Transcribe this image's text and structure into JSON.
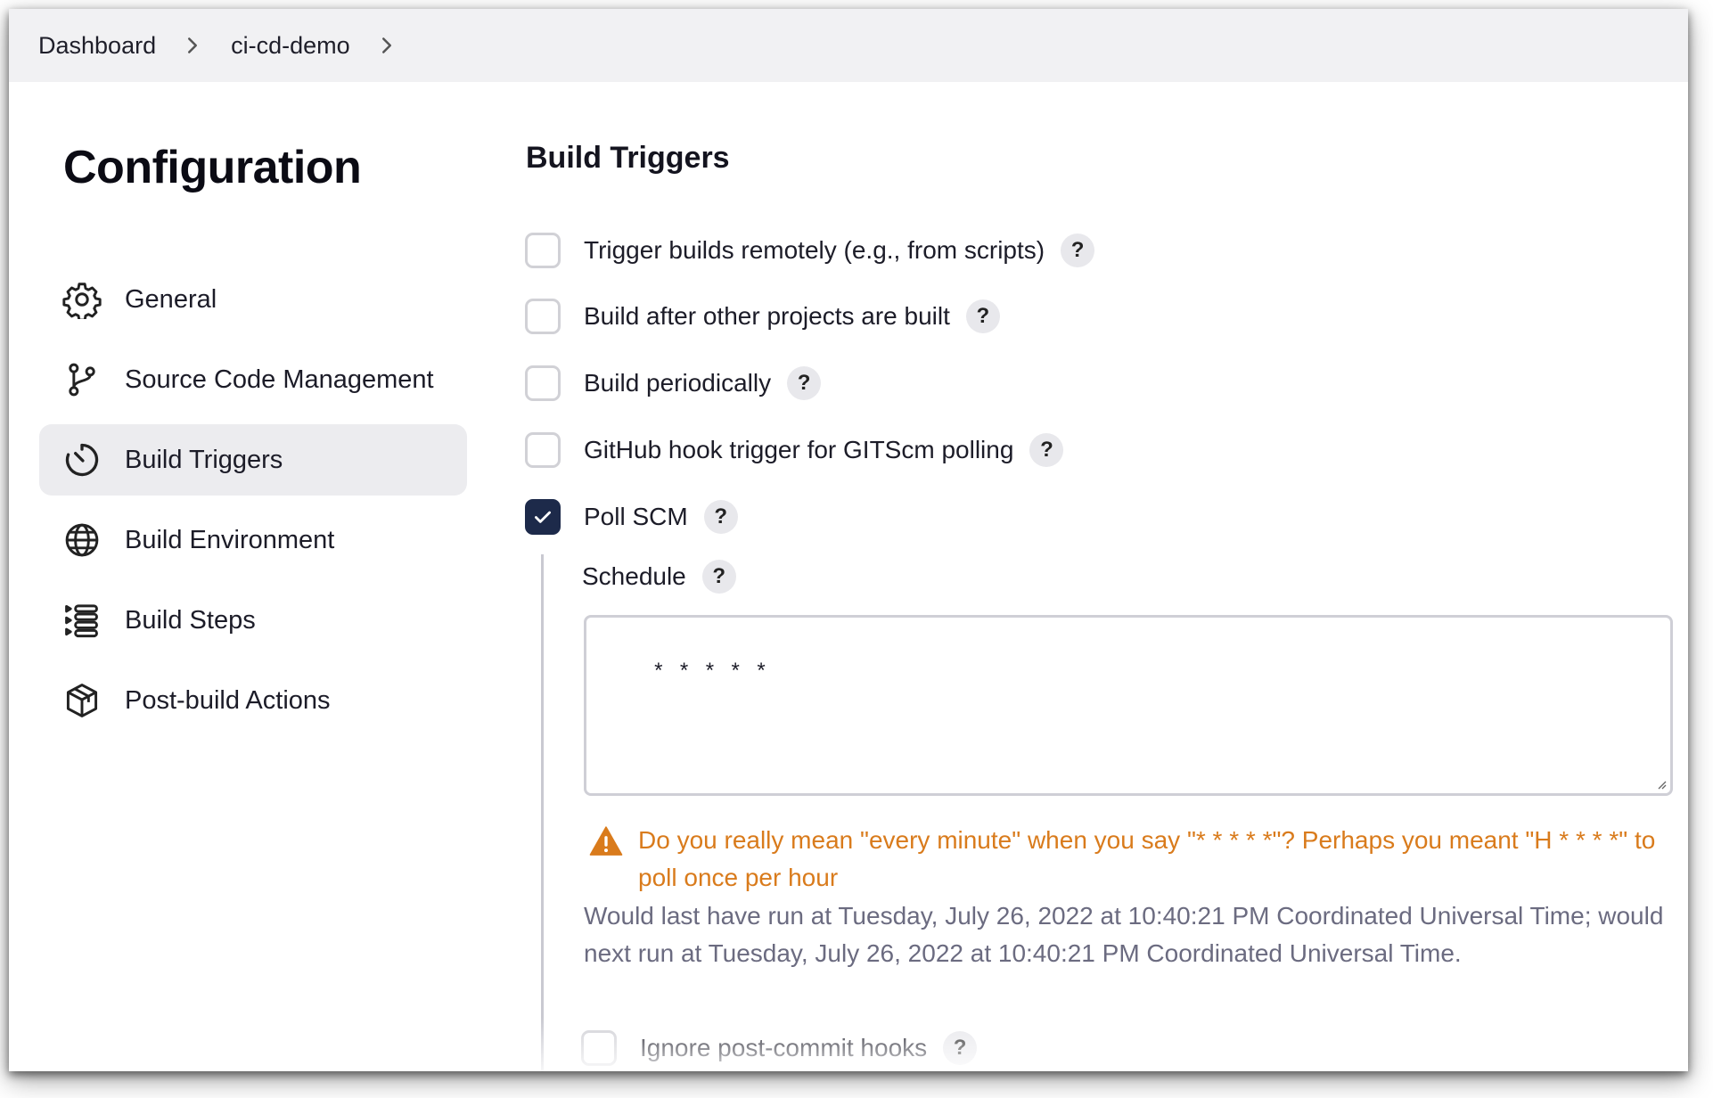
{
  "breadcrumb": {
    "items": [
      "Dashboard",
      "ci-cd-demo"
    ]
  },
  "page_title": "Configuration",
  "sidebar": {
    "items": [
      {
        "label": "General",
        "icon": "gear-icon",
        "active": false
      },
      {
        "label": "Source Code Management",
        "icon": "git-branch-icon",
        "active": false
      },
      {
        "label": "Build Triggers",
        "icon": "clock-icon",
        "active": true
      },
      {
        "label": "Build Environment",
        "icon": "globe-icon",
        "active": false
      },
      {
        "label": "Build Steps",
        "icon": "list-steps-icon",
        "active": false
      },
      {
        "label": "Post-build Actions",
        "icon": "package-icon",
        "active": false
      }
    ]
  },
  "main": {
    "section_title": "Build Triggers",
    "triggers": [
      {
        "label": "Trigger builds remotely (e.g., from scripts)",
        "checked": false
      },
      {
        "label": "Build after other projects are built",
        "checked": false
      },
      {
        "label": "Build periodically",
        "checked": false
      },
      {
        "label": "GitHub hook trigger for GITScm polling",
        "checked": false
      },
      {
        "label": "Poll SCM",
        "checked": true
      }
    ],
    "help_label": "?",
    "schedule": {
      "label": "Schedule",
      "value": "* * * * *",
      "warning": "Do you really mean \"every minute\" when you say \"* * * * *\"? Perhaps you meant \"H * * * *\" to poll once per hour",
      "info": "Would last have run at Tuesday, July 26, 2022 at 10:40:21 PM Coordinated Universal Time; would next run at Tuesday, July 26, 2022 at 10:40:21 PM Coordinated Universal Time."
    },
    "ignore_hooks": {
      "label": "Ignore post-commit hooks",
      "checked": false
    }
  },
  "colors": {
    "accent": "#1d2a4a",
    "warning": "#d97b1c",
    "muted_text": "#6b6b80",
    "active_bg": "#ececef"
  }
}
